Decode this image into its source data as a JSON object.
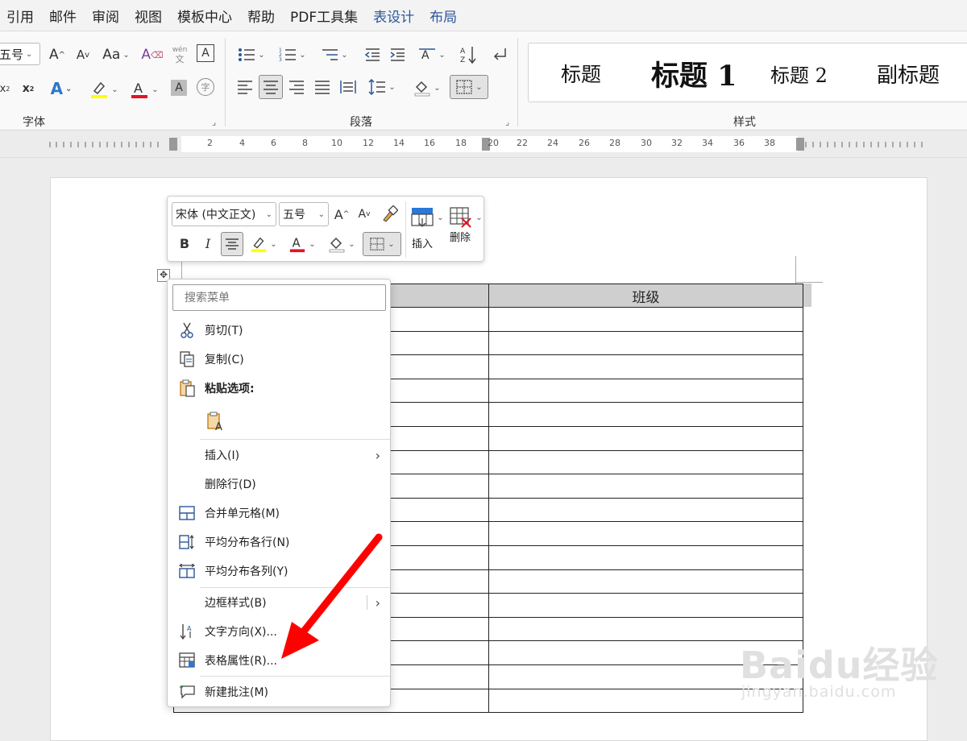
{
  "menubar": {
    "tabs": [
      "引用",
      "邮件",
      "审阅",
      "视图",
      "模板中心",
      "帮助",
      "PDF工具集",
      "表设计",
      "布局"
    ]
  },
  "ribbon": {
    "font_group_label": "字体",
    "paragraph_group_label": "段落",
    "styles_group_label": "样式",
    "font_size_value": "五号",
    "phonetic_top": "wén",
    "phonetic_bottom": "文",
    "case_label": "Aa",
    "styles": [
      "标题",
      "标题 1",
      "标题 2",
      "副标题"
    ]
  },
  "ruler": {
    "numbers": [
      "2",
      "4",
      "6",
      "8",
      "10",
      "12",
      "14",
      "16",
      "18",
      "20",
      "22",
      "24",
      "26",
      "28",
      "30",
      "32",
      "34",
      "36",
      "38"
    ]
  },
  "minitoolbar": {
    "font_name": "宋体 (中文正文)",
    "font_size": "五号",
    "insert_label": "插入",
    "delete_label": "删除",
    "bold_label": "B",
    "italic_label": "I"
  },
  "table": {
    "header_col2": "班级"
  },
  "context_menu": {
    "search_placeholder": "搜索菜单",
    "items": {
      "cut": "剪切(T)",
      "copy": "复制(C)",
      "paste_options": "粘贴选项:",
      "insert": "插入(I)",
      "delete_row": "删除行(D)",
      "merge_cells": "合并单元格(M)",
      "distribute_rows": "平均分布各行(N)",
      "distribute_cols": "平均分布各列(Y)",
      "border_styles": "边框样式(B)",
      "text_direction": "文字方向(X)...",
      "table_properties": "表格属性(R)...",
      "new_comment": "新建批注(M)"
    }
  },
  "watermark": {
    "brand": "Baidu经验",
    "url": "jingyan.baidu.com"
  },
  "colors": {
    "accent": "#2b579a",
    "highlight": "#ffff00",
    "font_red": "#e81123",
    "arrow_red": "#ff0000"
  }
}
